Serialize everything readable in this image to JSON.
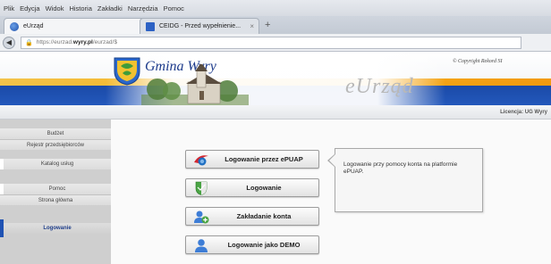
{
  "browser": {
    "menu": [
      "Plik",
      "Edycja",
      "Widok",
      "Historia",
      "Zakładki",
      "Narzędzia",
      "Pomoc"
    ],
    "tabs": [
      {
        "label": "eUrząd",
        "active": true
      },
      {
        "label": "CEIDG - Przed wypełnienie...",
        "active": false
      }
    ],
    "newtab_symbol": "+",
    "close_symbol": "×",
    "url_prefix": "https://eurzad.",
    "url_domain": "wyry.pl",
    "url_suffix": "/eurzad/$"
  },
  "header": {
    "municipality_title": "Gmina Wyry",
    "app_title": "eUrząd",
    "copyright": "© Copyright Rekord SI",
    "license": "Licencja: UG Wyry"
  },
  "sidebar": {
    "items": [
      "Budżet",
      "Rejestr przedsiębiorców",
      "Katalog usług",
      "Pomoc",
      "Strona główna",
      "Logowanie"
    ],
    "active_index": 5
  },
  "login": {
    "buttons": [
      {
        "label": "Logowanie przez ePUAP",
        "icon": "epuap-logo-icon"
      },
      {
        "label": "Logowanie",
        "icon": "shield-icon"
      },
      {
        "label": "Zakładanie konta",
        "icon": "add-user-icon"
      },
      {
        "label": "Logowanie jako DEMO",
        "icon": "user-icon"
      }
    ],
    "info_text": "Logowanie przy pomocy konta na platformie ePUAP."
  },
  "colors": {
    "header_blue": "#1f52b3",
    "header_orange": "#f7b21e",
    "sidebar_bg": "#cfcfcf",
    "active_text": "#1f3e8a"
  }
}
